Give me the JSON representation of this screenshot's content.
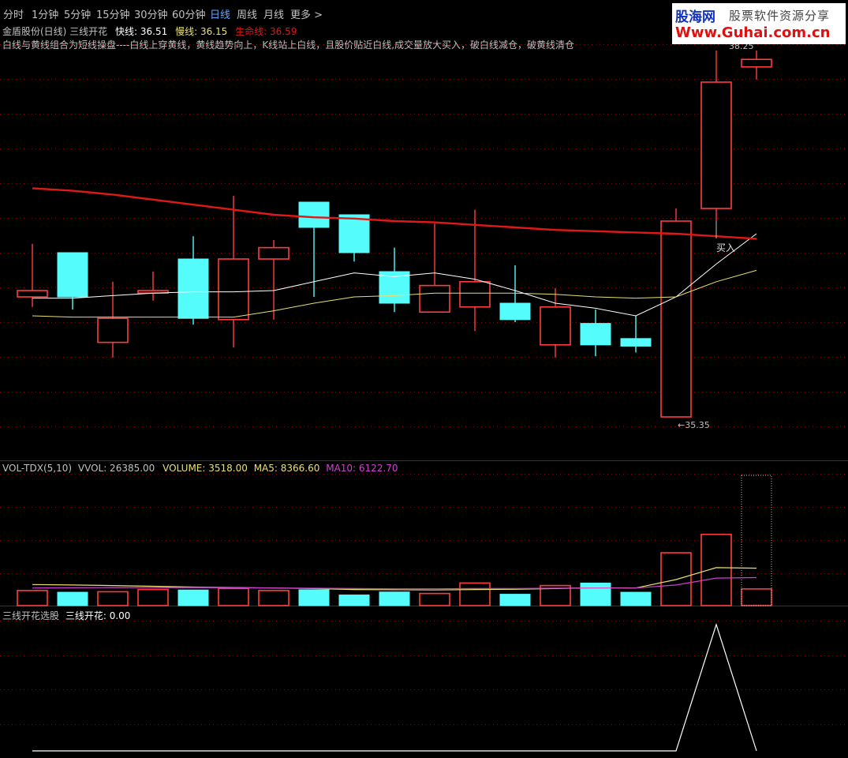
{
  "toolbar": {
    "tabs": [
      "分时",
      "1分钟",
      "5分钟",
      "15分钟",
      "30分钟",
      "60分钟",
      "日线",
      "周线",
      "月线",
      "更多 >"
    ],
    "active_tab": "日线"
  },
  "logo": {
    "name": "股海网",
    "tagline": "股票软件资源分享",
    "url": "Www.Guhai.com.cn"
  },
  "price_panel": {
    "title": "金盾股份(日线) 三线开花",
    "fast_label": "快线:",
    "fast_value": "36.51",
    "slow_label": "慢线:",
    "slow_value": "36.15",
    "life_label": "生命线:",
    "life_value": "36.59",
    "description": "白线与黄线组合为短线操盘----白线上穿黄线，黄线趋势向上，K线站上白线，且股价贴近白线,成交量放大买入，破白线减仓，破黄线清仓",
    "buy_label": "买入",
    "low_label": "35.35",
    "high_label": "38.25"
  },
  "volume_panel": {
    "name": "VOL-TDX(5,10)",
    "vvol": "VVOL: 26385.00",
    "volume": "VOLUME: 3518.00",
    "ma5": "MA5: 8366.60",
    "ma10": "MA10: 6122.70"
  },
  "signal_panel": {
    "name": "三线开花选股",
    "value": "三线开花: 0.00"
  },
  "colors": {
    "up": "#ff3c3c",
    "down": "#54fcfc",
    "life_line": "#e01818",
    "fast_line": "#ffffff",
    "slow_line": "#e8e070",
    "ma10": "#d040d0",
    "active_tab": "#5fa8ff"
  },
  "chart_data": [
    {
      "type": "candlestick",
      "title": "金盾股份(日线) 三线开花",
      "ylim": [
        35.0,
        38.3
      ],
      "candles": [
        {
          "open": 36.3,
          "high": 36.72,
          "low": 36.22,
          "close": 36.35,
          "dir": "up"
        },
        {
          "open": 36.65,
          "high": 36.65,
          "low": 36.2,
          "close": 36.3,
          "dir": "down"
        },
        {
          "open": 35.94,
          "high": 36.42,
          "low": 35.82,
          "close": 36.13,
          "dir": "up"
        },
        {
          "open": 36.33,
          "high": 36.5,
          "low": 36.27,
          "close": 36.35,
          "dir": "up"
        },
        {
          "open": 36.6,
          "high": 36.78,
          "low": 36.08,
          "close": 36.13,
          "dir": "down"
        },
        {
          "open": 36.12,
          "high": 37.1,
          "low": 35.9,
          "close": 36.6,
          "dir": "up"
        },
        {
          "open": 36.6,
          "high": 36.75,
          "low": 36.12,
          "close": 36.69,
          "dir": "up"
        },
        {
          "open": 37.05,
          "high": 37.05,
          "low": 36.3,
          "close": 36.85,
          "dir": "down"
        },
        {
          "open": 36.95,
          "high": 36.95,
          "low": 36.58,
          "close": 36.65,
          "dir": "down"
        },
        {
          "open": 36.5,
          "high": 36.69,
          "low": 36.18,
          "close": 36.25,
          "dir": "down"
        },
        {
          "open": 36.18,
          "high": 36.88,
          "low": 36.18,
          "close": 36.39,
          "dir": "up"
        },
        {
          "open": 36.22,
          "high": 36.99,
          "low": 36.03,
          "close": 36.42,
          "dir": "up"
        },
        {
          "open": 36.25,
          "high": 36.55,
          "low": 36.1,
          "close": 36.12,
          "dir": "down"
        },
        {
          "open": 35.92,
          "high": 36.37,
          "low": 35.82,
          "close": 36.22,
          "dir": "up"
        },
        {
          "open": 36.09,
          "high": 36.2,
          "low": 35.83,
          "close": 35.92,
          "dir": "down"
        },
        {
          "open": 35.97,
          "high": 36.15,
          "low": 35.86,
          "close": 35.91,
          "dir": "down"
        },
        {
          "open": 35.35,
          "high": 37.0,
          "low": 35.35,
          "close": 36.9,
          "dir": "up"
        },
        {
          "open": 37.0,
          "high": 38.25,
          "low": 36.9,
          "close": 38.0,
          "dir": "up"
        },
        {
          "open": 38.12,
          "high": 38.25,
          "low": 38.02,
          "close": 38.18,
          "dir": "up"
        }
      ],
      "series": [
        {
          "name": "快线",
          "values": [
            36.29,
            36.29,
            36.31,
            36.33,
            36.34,
            36.34,
            36.35,
            36.42,
            36.49,
            36.46,
            36.49,
            36.44,
            36.35,
            36.25,
            36.21,
            36.15,
            36.3,
            36.56,
            36.8
          ]
        },
        {
          "name": "慢线",
          "values": [
            36.15,
            36.14,
            36.14,
            36.14,
            36.14,
            36.14,
            36.19,
            36.25,
            36.3,
            36.31,
            36.33,
            36.33,
            36.33,
            36.32,
            36.3,
            36.29,
            36.3,
            36.42,
            36.51
          ]
        },
        {
          "name": "生命线",
          "values": [
            37.16,
            37.14,
            37.11,
            37.07,
            37.03,
            36.99,
            36.95,
            36.93,
            36.92,
            36.9,
            36.89,
            36.87,
            36.85,
            36.83,
            36.82,
            36.81,
            36.8,
            36.78,
            36.76
          ]
        }
      ]
    },
    {
      "type": "bar",
      "title": "VOL-TDX(5,10)",
      "ylim": [
        0,
        26385
      ],
      "series": [
        {
          "name": "VOLUME",
          "values": [
            3200,
            2850,
            2950,
            3400,
            3300,
            3600,
            3200,
            3350,
            2300,
            2900,
            2600,
            4700,
            2450,
            4200,
            4700,
            2850,
            10800,
            14500,
            3518
          ]
        },
        {
          "name": "MA5",
          "values": [
            4400,
            4300,
            4200,
            4050,
            3900,
            3800,
            3700,
            3600,
            3400,
            3350,
            3300,
            3400,
            3450,
            3600,
            3750,
            3700,
            5400,
            7800,
            7700
          ]
        },
        {
          "name": "MA10",
          "values": [
            3700,
            3750,
            3800,
            3800,
            3800,
            3750,
            3700,
            3650,
            3600,
            3550,
            3550,
            3600,
            3600,
            3650,
            3700,
            3700,
            4300,
            5700,
            5800
          ]
        }
      ],
      "dirs": [
        "up",
        "down",
        "up",
        "up",
        "down",
        "up",
        "up",
        "down",
        "down",
        "down",
        "up",
        "up",
        "down",
        "up",
        "down",
        "down",
        "up",
        "up",
        "up"
      ]
    },
    {
      "type": "line",
      "title": "三线开花选股",
      "ylim": [
        0,
        1
      ],
      "series": [
        {
          "name": "三线开花",
          "values": [
            0,
            0,
            0,
            0,
            0,
            0,
            0,
            0,
            0,
            0,
            0,
            0,
            0,
            0,
            0,
            0,
            0,
            1,
            0
          ]
        }
      ]
    }
  ]
}
